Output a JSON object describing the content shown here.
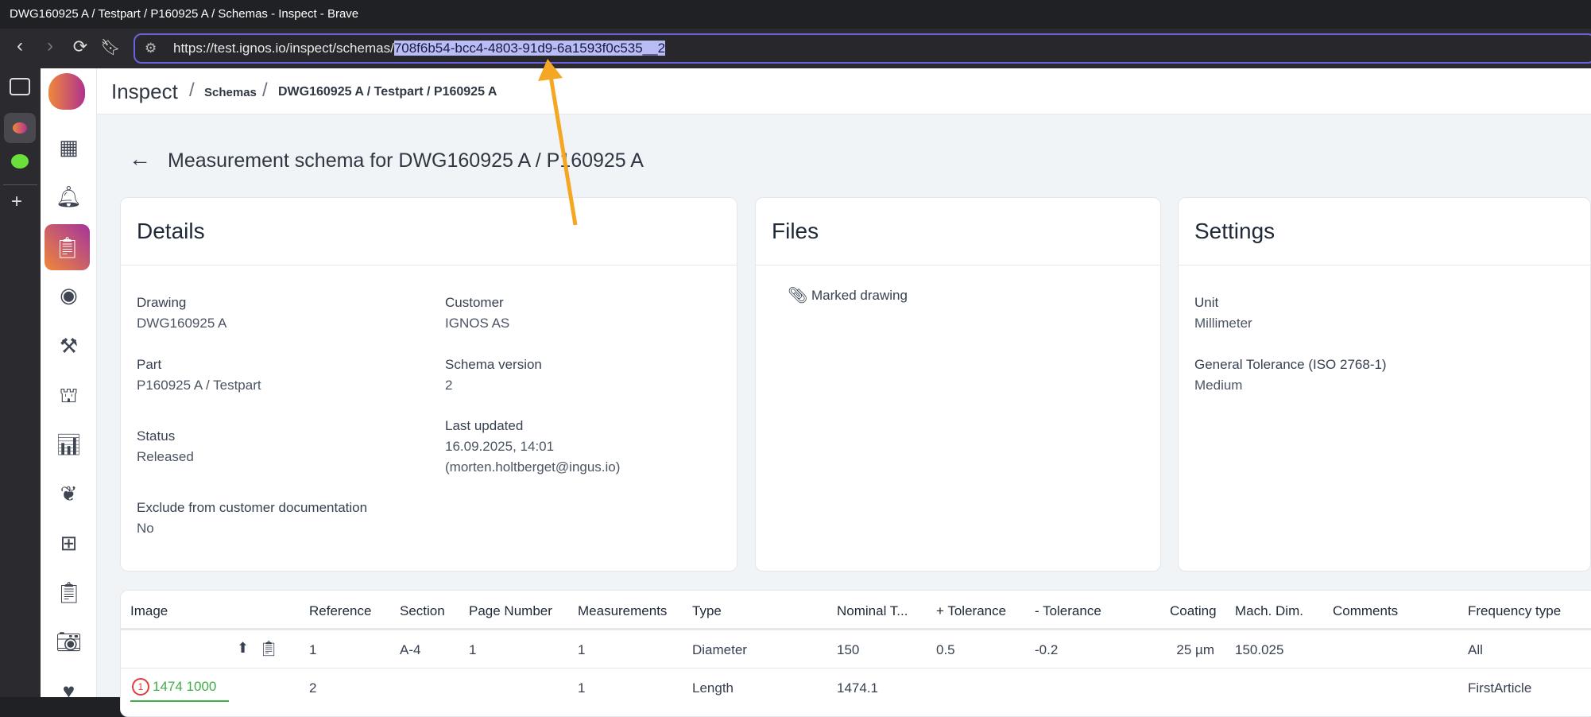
{
  "browser": {
    "window_title": "DWG160925 A / Testpart / P160925 A / Schemas - Inspect - Brave",
    "url_prefix": "https://test.ignos.io/inspect/schemas/",
    "url_selected": "708f6b54-bcc4-4803-91d9-6a1593f0c535__2"
  },
  "header": {
    "app": "Inspect",
    "crumb1": "Schemas",
    "crumb2": "DWG160925 A / Testpart / P160925 A"
  },
  "page_title": "Measurement schema for DWG160925 A / P160925 A",
  "details": {
    "title": "Details",
    "fields": [
      {
        "label": "Drawing",
        "value": "DWG160925 A"
      },
      {
        "label": "Customer",
        "value": "IGNOS AS"
      },
      {
        "label": "Part",
        "value": "P160925 A / Testpart"
      },
      {
        "label": "Schema version",
        "value": "2"
      },
      {
        "label": "Status",
        "value": "Released"
      },
      {
        "label": "Last updated",
        "value": "16.09.2025, 14:01",
        "value2": "(morten.holtberget@ingus.io)"
      },
      {
        "label": "Exclude from customer documentation",
        "value": "No"
      }
    ]
  },
  "files": {
    "title": "Files",
    "items": [
      "Marked drawing"
    ]
  },
  "settings": {
    "title": "Settings",
    "fields": [
      {
        "label": "Unit",
        "value": "Millimeter"
      },
      {
        "label": "General Tolerance (ISO 2768-1)",
        "value": "Medium"
      }
    ]
  },
  "table": {
    "columns": [
      "Image",
      "Reference",
      "Section",
      "Page Number",
      "Measurements",
      "Type",
      "Nominal T...",
      "+ Tolerance",
      "- Tolerance",
      "Coating",
      "Mach. Dim.",
      "Comments",
      "Frequency type"
    ],
    "rows": [
      [
        "",
        "1",
        "A-4",
        "1",
        "1",
        "Diameter",
        "150",
        "0.5",
        "-0.2",
        "25 µm",
        "150.025",
        "",
        "All"
      ],
      [
        "1474 1000",
        "2",
        "",
        "",
        "1",
        "Length",
        "1474.1",
        "",
        "",
        "",
        "",
        "",
        "FirstArticle"
      ]
    ],
    "row2_badge": "1"
  },
  "colors": {
    "accent": "#6a62e0",
    "arrow": "#f5a623",
    "green": "#3fae49"
  }
}
